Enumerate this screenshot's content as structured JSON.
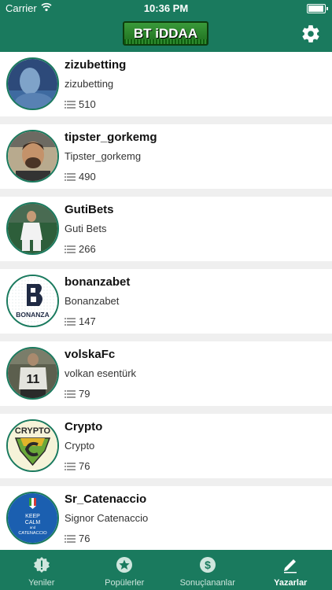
{
  "status_bar": {
    "carrier": "Carrier",
    "time": "10:36 PM",
    "battery_level": 0.95
  },
  "header": {
    "logo_text": "BT iDDAA",
    "settings_icon": "gear-icon"
  },
  "colors": {
    "primary": "#1a7a5e",
    "tab_inactive": "#cfe6de",
    "background": "#efefef"
  },
  "tipsters": [
    {
      "username": "zizubetting",
      "display_name": "zizubetting",
      "count": "510"
    },
    {
      "username": "tipster_gorkemg",
      "display_name": "Tipster_gorkemg",
      "count": "490"
    },
    {
      "username": "GutiBets",
      "display_name": "Guti Bets",
      "count": "266"
    },
    {
      "username": "bonanzabet",
      "display_name": "Bonanzabet",
      "count": "147"
    },
    {
      "username": "volskaFc",
      "display_name": "volkan esentürk",
      "count": "79"
    },
    {
      "username": "Crypto",
      "display_name": "Crypto",
      "count": "76"
    },
    {
      "username": "Sr_Catenaccio",
      "display_name": "Signor Catenaccio",
      "count": "76"
    }
  ],
  "avatar_text": {
    "bonanza": "BONANZA",
    "crypto": "CRYPTO",
    "volska_number": "11",
    "catenaccio_line1": "KEEP",
    "catenaccio_line2": "CALM",
    "catenaccio_line3": "and",
    "catenaccio_line4": "CATENACCIO"
  },
  "tabs": [
    {
      "label": "Yeniler",
      "icon": "alert-badge-icon",
      "active": false
    },
    {
      "label": "Popülerler",
      "icon": "star-icon",
      "active": false
    },
    {
      "label": "Sonuçlananlar",
      "icon": "dollar-icon",
      "active": false
    },
    {
      "label": "Yazarlar",
      "icon": "pencil-icon",
      "active": true
    }
  ]
}
